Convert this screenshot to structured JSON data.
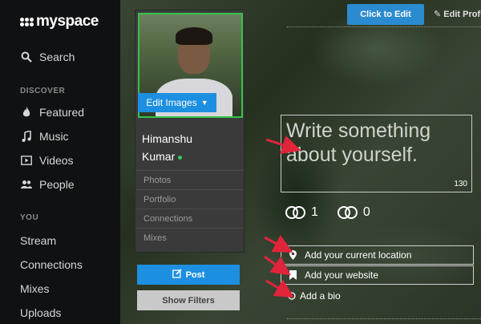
{
  "brand": {
    "name": "myspace"
  },
  "sidebar": {
    "search_label": "Search",
    "discover_label": "DISCOVER",
    "discover_items": [
      {
        "label": "Featured",
        "icon": "flame-icon"
      },
      {
        "label": "Music",
        "icon": "music-note-icon"
      },
      {
        "label": "Videos",
        "icon": "video-icon"
      },
      {
        "label": "People",
        "icon": "people-icon"
      }
    ],
    "you_label": "YOU",
    "you_items": [
      "Stream",
      "Connections",
      "Mixes",
      "Uploads"
    ]
  },
  "profile": {
    "edit_images_label": "Edit Images",
    "name_line1": "Himanshu",
    "name_line2": "Kumar",
    "links": [
      "Photos",
      "Portfolio",
      "Connections",
      "Mixes"
    ]
  },
  "actions": {
    "post_label": "Post",
    "show_filters_label": "Show Filters",
    "click_to_edit_label": "Click to Edit",
    "edit_profile_label": "Edit Profi"
  },
  "bio": {
    "placeholder": "Write something about yourself.",
    "char_count": "130"
  },
  "stats": {
    "connections_in": "1",
    "connections_out": "0"
  },
  "fields": {
    "location": "Add your current location",
    "website": "Add your website",
    "bio": "Add a bio"
  },
  "colors": {
    "accent_blue": "#1d8fe0",
    "online_green": "#2ecc56",
    "arrow_red": "#e0243a"
  }
}
